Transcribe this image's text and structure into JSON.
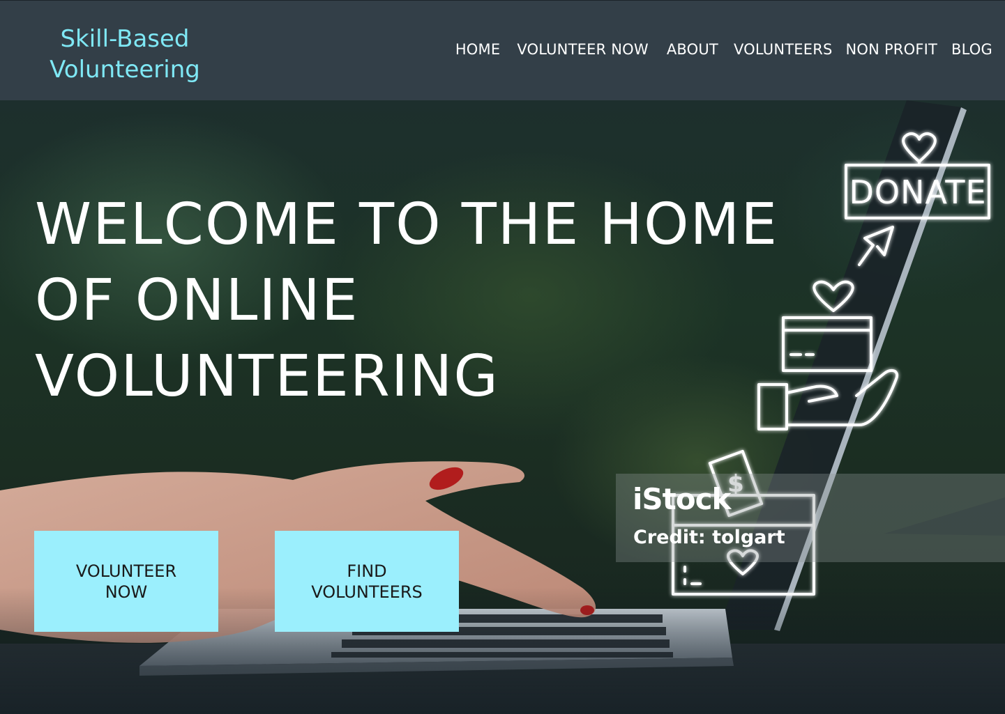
{
  "header": {
    "logo_line1": "Skill-Based",
    "logo_line2": "Volunteering",
    "nav": {
      "home": "HOME",
      "volunteer_now": "VOLUNTEER NOW",
      "about": "ABOUT",
      "volunteers": "VOLUNTEERS",
      "non_profit": "NON PROFIT",
      "blog": "BLOG"
    }
  },
  "hero": {
    "title_line1": "WELCOME TO THE HOME",
    "title_line2": "OF ONLINE",
    "title_line3": "VOLUNTEERING",
    "illustration": {
      "donate_label": "DONATE",
      "dollar_label": "$",
      "icons": [
        "heart-icon",
        "donate-sign-icon",
        "cursor-arrow-icon",
        "gift-card-icon",
        "giving-hand-icon",
        "dollar-bill-icon",
        "donation-box-icon",
        "laptop"
      ]
    },
    "watermark": {
      "brand": "iStock",
      "credit": "Credit: tolgart"
    },
    "buttons": {
      "volunteer_now_line1": "VOLUNTEER",
      "volunteer_now_line2": "NOW",
      "find_volunteers_line1": "FIND",
      "find_volunteers_line2": "VOLUNTEERS"
    }
  },
  "colors": {
    "header_bg": "#333f48",
    "logo": "#7fe8f5",
    "button_bg": "#9beffd",
    "hero_text": "#ffffff"
  }
}
